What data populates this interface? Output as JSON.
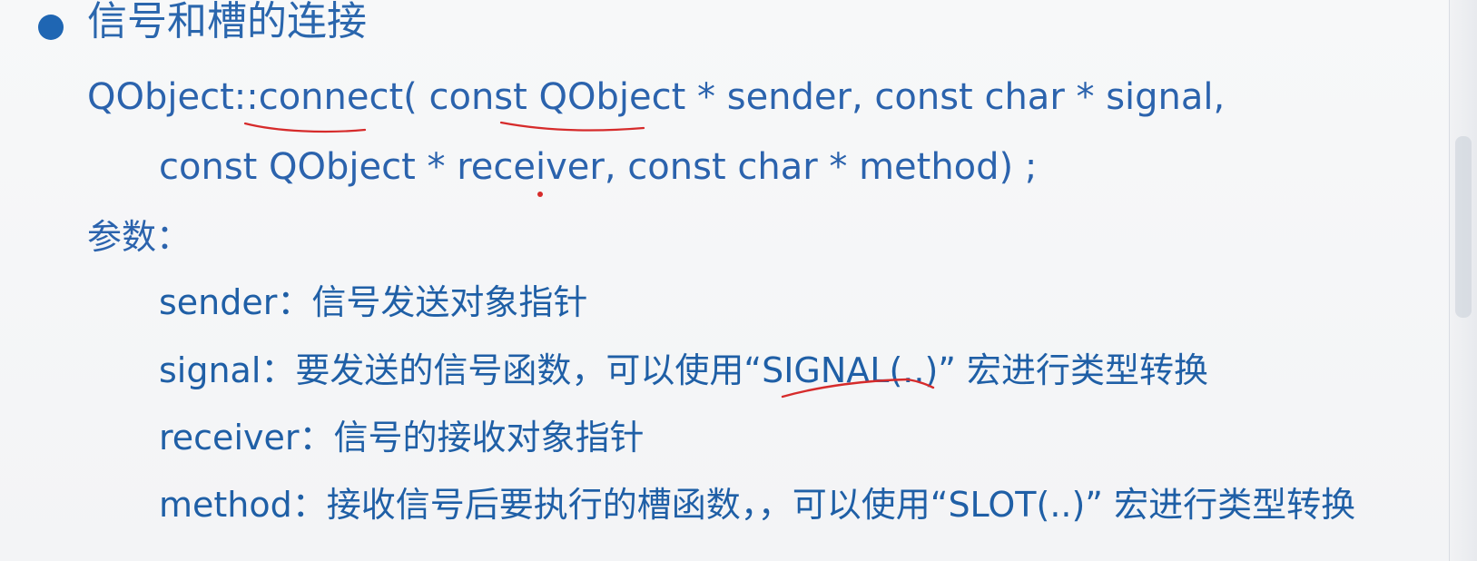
{
  "slide": {
    "title": "信号和槽的连接",
    "code_line_1": "QObject::connect( const QObject * sender, const char * signal,",
    "code_line_2": "const QObject * receiver, const char * method) ;",
    "params_label": "参数：",
    "items": [
      {
        "text": "sender：信号发送对象指针"
      },
      {
        "text": "signal：要发送的信号函数，可以使用“SIGNAL(..)” 宏进行类型转换"
      },
      {
        "text": "receiver：信号的接收对象指针"
      },
      {
        "text": "method：接收信号后要执行的槽函数，，可以使用“SLOT(..)” 宏进行类型转换"
      }
    ]
  },
  "colors": {
    "text": "#2b63ad",
    "bullet": "#1f66b3",
    "annotation": "#d62b2b",
    "background": "#f4f5f7"
  }
}
